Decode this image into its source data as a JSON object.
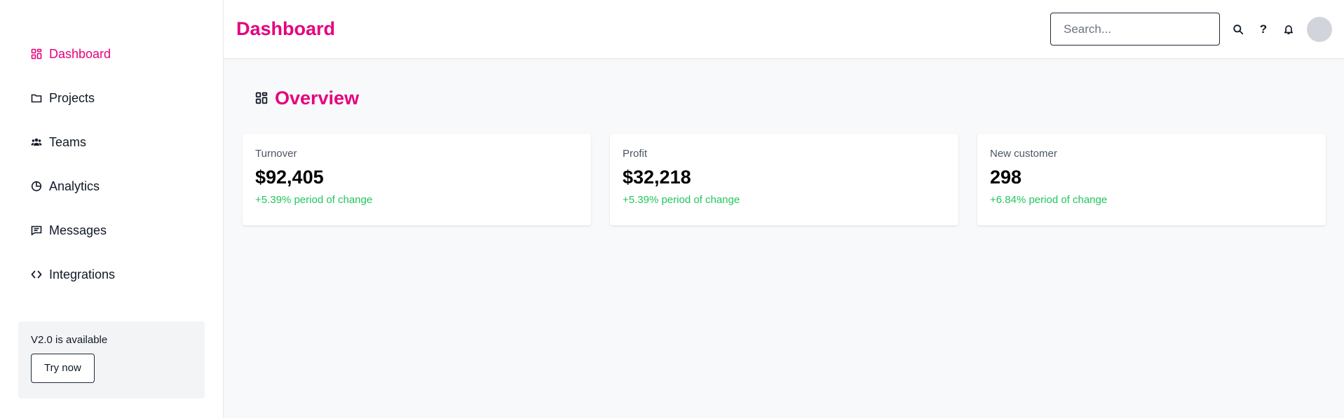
{
  "sidebar": {
    "items": [
      {
        "label": "Dashboard",
        "icon": "dashboard-grid-icon",
        "active": true
      },
      {
        "label": "Projects",
        "icon": "folder-icon",
        "active": false
      },
      {
        "label": "Teams",
        "icon": "users-icon",
        "active": false
      },
      {
        "label": "Analytics",
        "icon": "pie-chart-icon",
        "active": false
      },
      {
        "label": "Messages",
        "icon": "message-icon",
        "active": false
      },
      {
        "label": "Integrations",
        "icon": "code-icon",
        "active": false
      }
    ],
    "promo": {
      "text": "V2.0 is available",
      "button_label": "Try now"
    }
  },
  "header": {
    "title": "Dashboard",
    "search_placeholder": "Search...",
    "icons": [
      "search-icon",
      "help-icon",
      "bell-icon"
    ],
    "help_glyph": "?"
  },
  "main": {
    "section_title": "Overview",
    "section_icon": "dashboard-grid-icon",
    "cards": [
      {
        "label": "Turnover",
        "value": "$92,405",
        "change": "+5.39% period of change"
      },
      {
        "label": "Profit",
        "value": "$32,218",
        "change": "+5.39% period of change"
      },
      {
        "label": "New customer",
        "value": "298",
        "change": "+6.84% period of change"
      }
    ]
  },
  "colors": {
    "accent": "#e6007e",
    "positive": "#22c55e",
    "background": "#f8f9fb",
    "promo_background": "#f3f4f6"
  }
}
